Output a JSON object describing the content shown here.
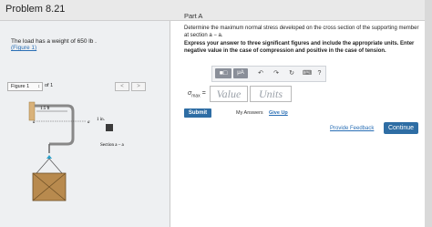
{
  "header": {
    "title": "Problem 8.21"
  },
  "problem": {
    "text": "The load has a weight of 650  lb .",
    "figure_link": "(Figure 1)"
  },
  "figure_nav": {
    "select_value": "Figure 1",
    "of_text": "of 1",
    "prev": "<",
    "next": ">"
  },
  "figure": {
    "dim_label": "1.5 ft",
    "point_a1": "a",
    "point_a2": "a",
    "inch_label": "1 in.",
    "section_label": "Section a – a"
  },
  "partA": {
    "title": "Part A",
    "question": "Determine the maximum normal stress developed on the cross section of the supporting member at section a − a.",
    "instruction": "Express your answer to three significant figures and include the appropriate units. Enter negative value in the case of compression and positive in the case of tension."
  },
  "toolbar": {
    "btn_templates": "■□",
    "btn_units": "μA",
    "btn_undo": "↶",
    "btn_redo": "↷",
    "btn_reset": "↻",
    "btn_keyboard": "⌨",
    "btn_help": "?"
  },
  "answer": {
    "symbol": "σ",
    "subscript": "max",
    "equals": "=",
    "value_placeholder": "Value",
    "units_placeholder": "Units"
  },
  "actions": {
    "submit": "Submit",
    "my_answers": "My Answers",
    "give_up": "Give Up",
    "feedback": "Provide Feedback",
    "continue": "Continue"
  },
  "colors": {
    "accent": "#2e6da4",
    "link": "#2a6fb5"
  }
}
